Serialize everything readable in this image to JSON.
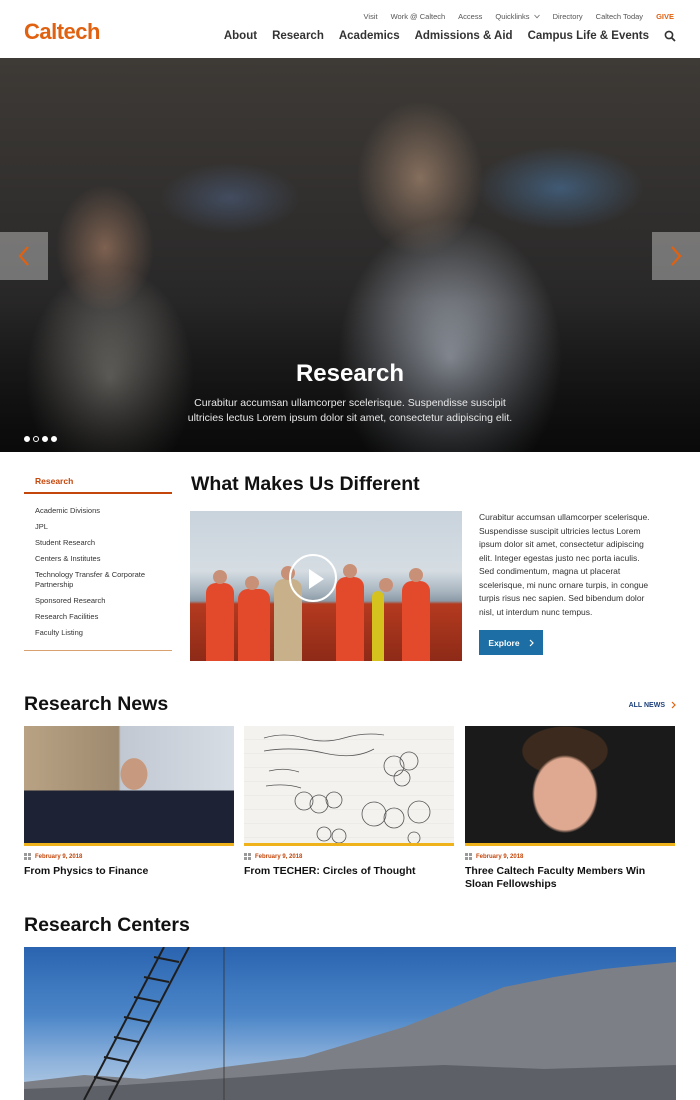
{
  "brand": {
    "logo_text": "Caltech",
    "accent": "#e06110"
  },
  "utility_nav": [
    "Visit",
    "Work @ Caltech",
    "Access",
    "Quicklinks",
    "Directory",
    "Caltech Today",
    "GIVE"
  ],
  "main_nav": [
    "About",
    "Research",
    "Academics",
    "Admissions & Aid",
    "Campus Life & Events"
  ],
  "hero": {
    "title": "Research",
    "subtitle": "Curabitur accumsan ullamcorper scelerisque. Suspendisse suscipit ultricies lectus Lorem ipsum dolor sit amet, consectetur adipiscing elit.",
    "slides": 4,
    "active_slide": 2
  },
  "sidebar": {
    "title": "Research",
    "items": [
      "Academic Divisions",
      "JPL",
      "Student Research",
      "Centers & Institutes",
      "Technology Transfer & Corporate Partnership",
      "Sponsored Research",
      "Research Facilities",
      "Faculty Listing"
    ]
  },
  "wmud": {
    "title": "What Makes Us Different",
    "body": "Curabitur accumsan ullamcorper scelerisque. Suspendisse suscipit ultricies lectus Lorem ipsum dolor sit amet, consectetur adipiscing elit. Integer egestas justo nec porta iaculis. Sed condimentum, magna ut placerat scelerisque, mi nunc ornare turpis, in congue turpis risus nec sapien. Sed bibendum dolor nisl, ut interdum nunc tempus.",
    "button": "Explore"
  },
  "news": {
    "title": "Research News",
    "all_link": "ALL NEWS",
    "items": [
      {
        "date": "February 9, 2018",
        "title": "From Physics to Finance"
      },
      {
        "date": "February 9, 2018",
        "title": "From TECHER: Circles of Thought"
      },
      {
        "date": "February 9, 2018",
        "title": "Three Caltech Faculty Members Win Sloan Fellowships"
      }
    ]
  },
  "centers": {
    "title": "Research Centers"
  }
}
